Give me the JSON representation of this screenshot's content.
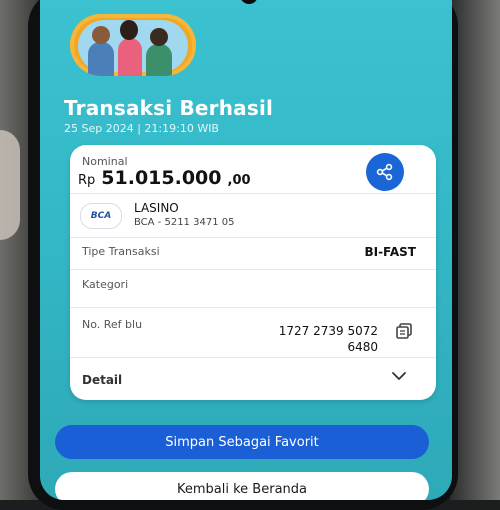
{
  "header": {
    "title": "Transaksi Berhasil",
    "datetime": "25 Sep 2024  |  21:19:10 WIB"
  },
  "nominal": {
    "label": "Nominal",
    "currency": "Rp",
    "amount": "51.015.000",
    "decimals": ",00",
    "share_icon": "share-icon"
  },
  "recipient": {
    "bank_logo_text": "BCA",
    "name": "LASINO",
    "account": "BCA - 5211 3471 05"
  },
  "details": {
    "tipe_label": "Tipe Transaksi",
    "tipe_value": "BI-FAST",
    "kategori_label": "Kategori",
    "ref_label": "No. Ref blu",
    "ref_line1": "1727 2739 5072",
    "ref_line2": "6480",
    "detail_label": "Detail"
  },
  "actions": {
    "favorite_label": "Simpan Sebagai Favorit",
    "home_label": "Kembali ke Beranda"
  },
  "colors": {
    "screen": "#3cc1d1",
    "primary": "#1a5fd6"
  }
}
